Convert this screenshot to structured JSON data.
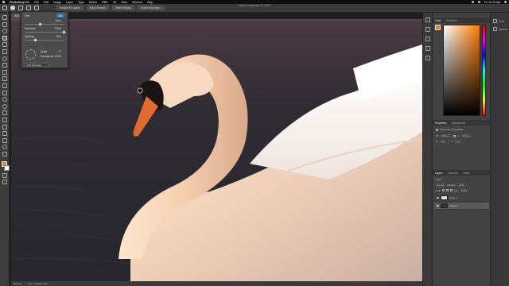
{
  "menubar": {
    "app": "Photoshop CC",
    "items": [
      "File",
      "Edit",
      "Image",
      "Layer",
      "Type",
      "Select",
      "Filter",
      "3D",
      "View",
      "Window",
      "Help"
    ],
    "clock": "Fri 11:25 AM"
  },
  "window_title": "Adobe Photoshop CC 2018",
  "options": {
    "mode_label": "Mode:",
    "mode_value": "Normal",
    "btn1": "Sample All Layers",
    "btn2": "Auto-Enhance",
    "btn3": "Select Subject",
    "btn4": "Select and Mask..."
  },
  "document_tab": "IMG_8804.jpg @ 66.7% (Layer 0, RGB/8)",
  "brush_panel": {
    "size_label": "Size:",
    "size_value": "13 px",
    "hardness_label": "Hardness:",
    "hardness_value": "100%",
    "spacing_label": "Spacing:",
    "spacing_value": "25%",
    "angle_label": "Angle:",
    "angle_value": "0°",
    "roundness_label": "Roundness:",
    "roundness_value": "100%",
    "pressure_label": "Pen Pressure",
    "ok_label": "OK"
  },
  "statusbar": {
    "zoom": "66.67%",
    "doc": "Doc: 17.2M/17.2M"
  },
  "panels": {
    "color_tabs": [
      "Color",
      "Swatches"
    ],
    "properties_tabs": [
      "Properties",
      "Adjustments"
    ],
    "properties": {
      "header": "Pixel Layer Properties",
      "w_label": "W:",
      "w_value": "4032 px",
      "h_label": "H:",
      "h_value": "3024 px",
      "x_label": "X:",
      "x_value": "0 px",
      "y_label": "Y:",
      "y_value": "0 px"
    },
    "layers_tabs": [
      "Layers",
      "Channels",
      "Paths"
    ],
    "layers_kind": "Kind",
    "blend_mode": "Normal",
    "opacity_label": "Opacity:",
    "opacity_value": "100%",
    "lock_label": "Lock:",
    "fill_label": "Fill:",
    "fill_value": "100%",
    "layers": [
      {
        "name": "Layer 1"
      },
      {
        "name": "Layer 0"
      }
    ],
    "far_dock": [
      "Color",
      "Libraries"
    ]
  },
  "colors": {
    "foreground": "#d98a2f",
    "background": "#ffffff",
    "accent": "#2f7ad8"
  }
}
